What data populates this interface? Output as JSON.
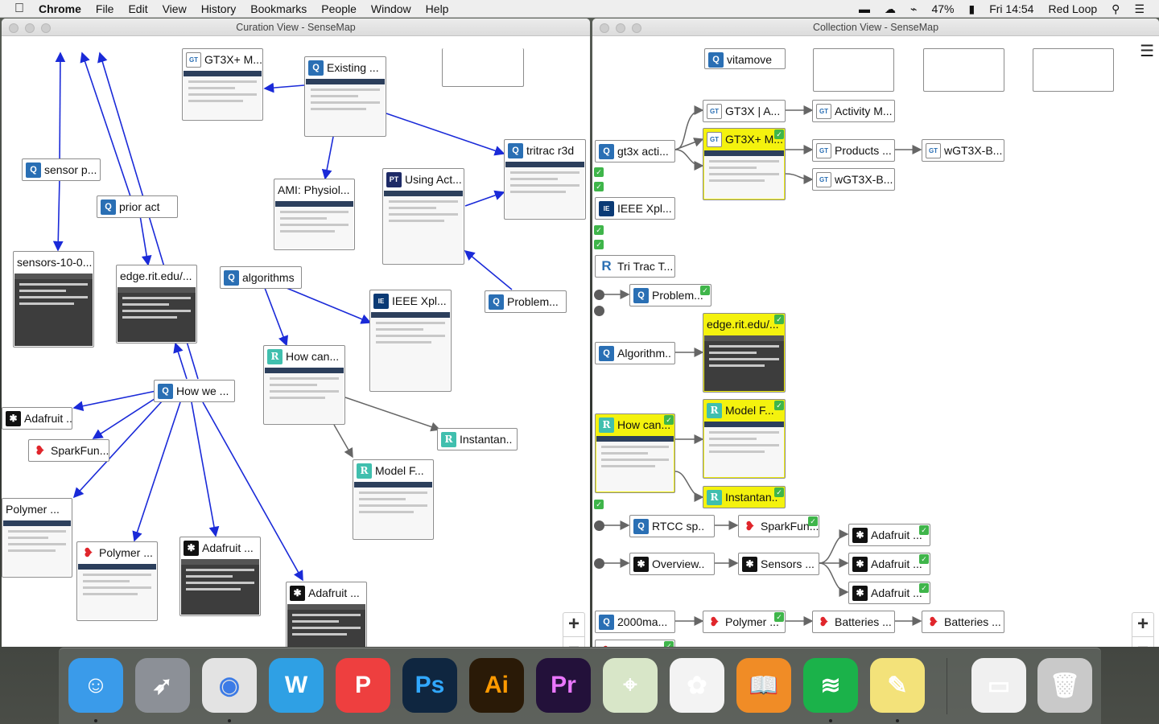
{
  "menubar": {
    "apple": "",
    "app": "Chrome",
    "items": [
      "File",
      "Edit",
      "View",
      "History",
      "Bookmarks",
      "People",
      "Window",
      "Help"
    ],
    "battery": "47%",
    "clock": "Fri 14:54",
    "user": "Red Loop"
  },
  "left_window": {
    "title": "Curation View - SenseMap",
    "nodes": [
      "GT3X+ M...",
      "Existing ...",
      "sensor p...",
      "prior act",
      "AMI: Physiol...",
      "Using Act...",
      "tritrac r3d",
      "sensors-10-0...",
      "edge.rit.edu/...",
      "algorithms",
      "IEEE Xpl...",
      "Problem...",
      "How can...",
      "How we ...",
      "Adafruit ...",
      "SparkFun...",
      "Instantan..",
      "Model F...",
      "Polymer ...",
      "Polymer ...",
      "Adafruit ...",
      "Adafruit ..."
    ],
    "zoom_in": "+",
    "zoom_out": "−"
  },
  "right_window": {
    "title": "Collection View - SenseMap",
    "nodes": [
      "vitamove",
      "gt3x acti...",
      "GT3X | A...",
      "GT3X+ M...",
      "Activity M...",
      "Products ...",
      "wGT3X-B...",
      "wGT3X-B...",
      "IEEE Xpl...",
      "Tri Trac T...",
      "Problem...",
      "edge.rit.edu/...",
      "Algorithm..",
      "How can...",
      "Model F...",
      "Instantan..",
      "RTCC sp..",
      "SparkFun...",
      "Overview..",
      "Sensors ...",
      "Adafruit ...",
      "Adafruit ...",
      "Adafruit ...",
      "2000ma...",
      "Polymer ...",
      "Batteries ...",
      "Batteries ...",
      "Polymer ..."
    ],
    "zoom_in": "+",
    "zoom_out": "−"
  },
  "dock": {
    "apps": [
      "Finder",
      "Launchpad",
      "Chrome",
      "Word",
      "Pocket",
      "Photoshop",
      "Illustrator",
      "Premiere",
      "Maps",
      "Photos",
      "iBooks",
      "Spotify",
      "Notes",
      "Document",
      "Trash"
    ]
  },
  "colors": {
    "edge_blue": "#1a2ad8",
    "edge_gray": "#666666",
    "selected": "#f4f20e",
    "check": "#3fb54a"
  }
}
